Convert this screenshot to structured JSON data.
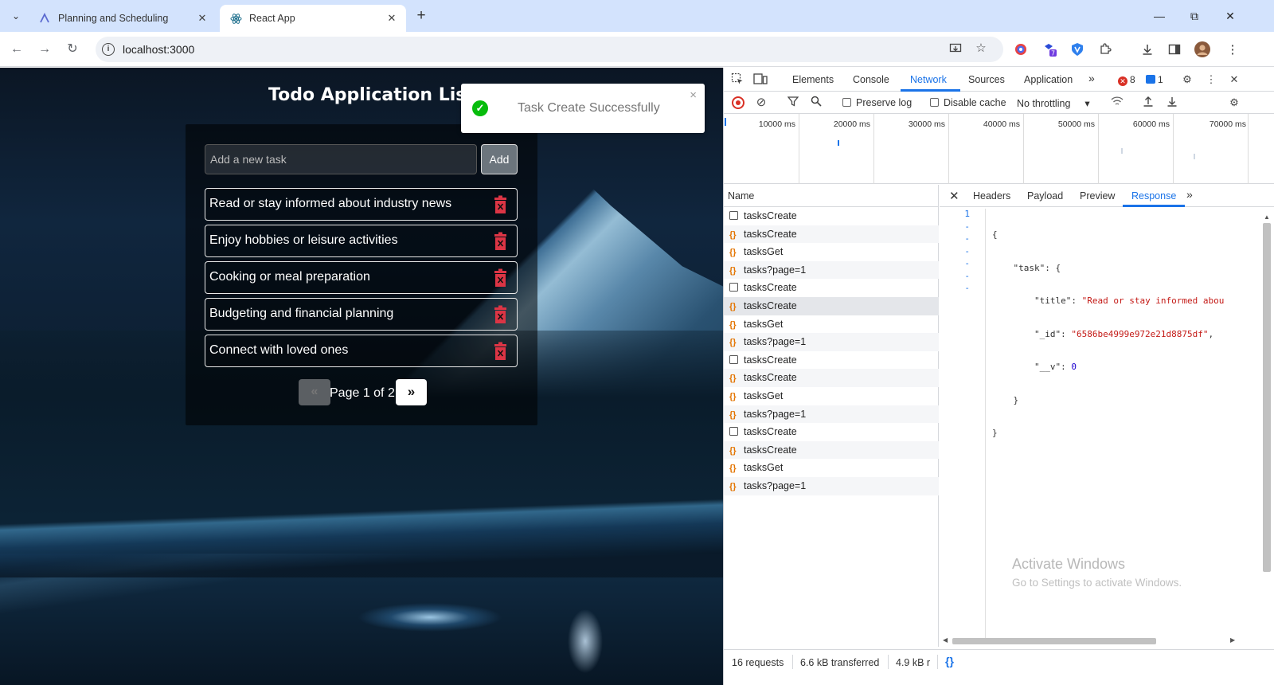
{
  "browser": {
    "tabs": [
      {
        "title": "Planning and Scheduling",
        "active": false
      },
      {
        "title": "React App",
        "active": true
      }
    ],
    "url": "localhost:3000"
  },
  "app": {
    "title": "Todo Application List",
    "input_placeholder": "Add a new task",
    "add_label": "Add",
    "tasks": [
      "Read or stay informed about industry news",
      "Enjoy hobbies or leisure activities",
      "Cooking or meal preparation",
      "Budgeting and financial planning",
      "Connect with loved ones"
    ],
    "pagination": {
      "prev": "«",
      "label": "Page 1 of 2",
      "next": "»"
    },
    "toast": "Task Create Successfully",
    "toast_close": "×"
  },
  "devtools": {
    "tabs": [
      "Elements",
      "Console",
      "Network",
      "Sources",
      "Application"
    ],
    "active_tab": "Network",
    "error_count": "8",
    "message_count": "1",
    "preserve_log_label": "Preserve log",
    "disable_cache_label": "Disable cache",
    "throttling": "No throttling",
    "timeline_labels": [
      "10000 ms",
      "20000 ms",
      "30000 ms",
      "40000 ms",
      "50000 ms",
      "60000 ms",
      "70000 ms"
    ],
    "name_header": "Name",
    "requests": [
      {
        "name": "tasksCreate",
        "kind": "doc"
      },
      {
        "name": "tasksCreate",
        "kind": "fetch"
      },
      {
        "name": "tasksGet",
        "kind": "fetch"
      },
      {
        "name": "tasks?page=1",
        "kind": "fetch"
      },
      {
        "name": "tasksCreate",
        "kind": "doc"
      },
      {
        "name": "tasksCreate",
        "kind": "fetch"
      },
      {
        "name": "tasksGet",
        "kind": "fetch"
      },
      {
        "name": "tasks?page=1",
        "kind": "fetch"
      },
      {
        "name": "tasksCreate",
        "kind": "doc"
      },
      {
        "name": "tasksCreate",
        "kind": "fetch"
      },
      {
        "name": "tasksGet",
        "kind": "fetch"
      },
      {
        "name": "tasks?page=1",
        "kind": "fetch"
      },
      {
        "name": "tasksCreate",
        "kind": "doc"
      },
      {
        "name": "tasksCreate",
        "kind": "fetch"
      },
      {
        "name": "tasksGet",
        "kind": "fetch"
      },
      {
        "name": "tasks?page=1",
        "kind": "fetch"
      }
    ],
    "selected_request": 5,
    "detail_tabs": [
      "Headers",
      "Payload",
      "Preview",
      "Response"
    ],
    "active_detail_tab": "Response",
    "response": {
      "line_numbers": [
        "1",
        "-",
        "-",
        "-",
        "-",
        "-",
        "-"
      ],
      "title_value": "\"Read or stay informed abou",
      "id_value": "\"6586be4999e972e21d8875df\"",
      "v_value": "0"
    },
    "watermark": {
      "line1": "Activate Windows",
      "line2": "Go to Settings to activate Windows."
    },
    "status": {
      "requests": "16 requests",
      "transferred": "6.6 kB transferred",
      "resources": "4.9 kB r"
    }
  },
  "colors": {
    "accent": "#1a73e8",
    "danger": "#dc3545",
    "success": "#07bc0c",
    "tabstrip": "#d3e3fd"
  }
}
